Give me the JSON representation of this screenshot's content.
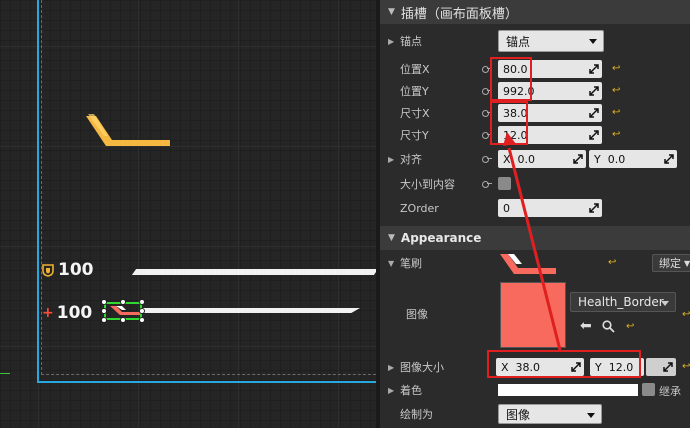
{
  "viewport": {
    "armor_value": "100",
    "health_value": "100"
  },
  "panel": {
    "title": "插槽（画布面板槽）",
    "anchor": {
      "label": "锚点",
      "value": "锚点"
    },
    "pos_x": {
      "label": "位置X",
      "value": "80.0"
    },
    "pos_y": {
      "label": "位置Y",
      "value": "992.0"
    },
    "size_x": {
      "label": "尺寸X",
      "value": "38.0"
    },
    "size_y": {
      "label": "尺寸Y",
      "value": "12.0"
    },
    "alignment": {
      "label": "对齐",
      "x_prefix": "X",
      "x_value": "0.0",
      "y_prefix": "Y",
      "y_value": "0.0"
    },
    "size_to_content": {
      "label": "大小到内容"
    },
    "zorder": {
      "label": "ZOrder",
      "value": "0"
    },
    "appearance": {
      "title": "Appearance",
      "brush_label": "笔刷",
      "bind_button": "绑定",
      "image_label": "图像",
      "image_asset": "Health_Border",
      "image_size": {
        "label": "图像大小",
        "x_prefix": "X",
        "x_value": "38.0",
        "y_prefix": "Y",
        "y_value": "12.0"
      },
      "tint_label": "着色",
      "inherit_label": "继承",
      "draw_as": {
        "label": "绘制为",
        "value": "图像"
      }
    }
  },
  "colors": {
    "accent_blue": "#29a8e0",
    "highlight_red": "#e02020",
    "selection_green": "#2fd92f",
    "image_preview": "#f86a5e",
    "crosshair_yellow": "#f5b942"
  }
}
